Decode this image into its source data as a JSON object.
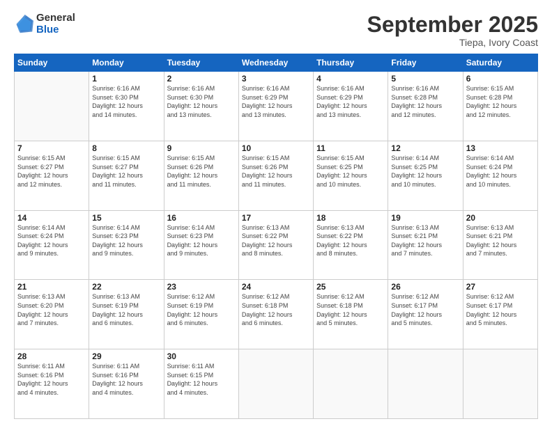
{
  "header": {
    "logo_general": "General",
    "logo_blue": "Blue",
    "month": "September 2025",
    "location": "Tiepa, Ivory Coast"
  },
  "weekdays": [
    "Sunday",
    "Monday",
    "Tuesday",
    "Wednesday",
    "Thursday",
    "Friday",
    "Saturday"
  ],
  "weeks": [
    [
      {
        "day": "",
        "info": ""
      },
      {
        "day": "1",
        "info": "Sunrise: 6:16 AM\nSunset: 6:30 PM\nDaylight: 12 hours\nand 14 minutes."
      },
      {
        "day": "2",
        "info": "Sunrise: 6:16 AM\nSunset: 6:30 PM\nDaylight: 12 hours\nand 13 minutes."
      },
      {
        "day": "3",
        "info": "Sunrise: 6:16 AM\nSunset: 6:29 PM\nDaylight: 12 hours\nand 13 minutes."
      },
      {
        "day": "4",
        "info": "Sunrise: 6:16 AM\nSunset: 6:29 PM\nDaylight: 12 hours\nand 13 minutes."
      },
      {
        "day": "5",
        "info": "Sunrise: 6:16 AM\nSunset: 6:28 PM\nDaylight: 12 hours\nand 12 minutes."
      },
      {
        "day": "6",
        "info": "Sunrise: 6:15 AM\nSunset: 6:28 PM\nDaylight: 12 hours\nand 12 minutes."
      }
    ],
    [
      {
        "day": "7",
        "info": "Sunrise: 6:15 AM\nSunset: 6:27 PM\nDaylight: 12 hours\nand 12 minutes."
      },
      {
        "day": "8",
        "info": "Sunrise: 6:15 AM\nSunset: 6:27 PM\nDaylight: 12 hours\nand 11 minutes."
      },
      {
        "day": "9",
        "info": "Sunrise: 6:15 AM\nSunset: 6:26 PM\nDaylight: 12 hours\nand 11 minutes."
      },
      {
        "day": "10",
        "info": "Sunrise: 6:15 AM\nSunset: 6:26 PM\nDaylight: 12 hours\nand 11 minutes."
      },
      {
        "day": "11",
        "info": "Sunrise: 6:15 AM\nSunset: 6:25 PM\nDaylight: 12 hours\nand 10 minutes."
      },
      {
        "day": "12",
        "info": "Sunrise: 6:14 AM\nSunset: 6:25 PM\nDaylight: 12 hours\nand 10 minutes."
      },
      {
        "day": "13",
        "info": "Sunrise: 6:14 AM\nSunset: 6:24 PM\nDaylight: 12 hours\nand 10 minutes."
      }
    ],
    [
      {
        "day": "14",
        "info": "Sunrise: 6:14 AM\nSunset: 6:24 PM\nDaylight: 12 hours\nand 9 minutes."
      },
      {
        "day": "15",
        "info": "Sunrise: 6:14 AM\nSunset: 6:23 PM\nDaylight: 12 hours\nand 9 minutes."
      },
      {
        "day": "16",
        "info": "Sunrise: 6:14 AM\nSunset: 6:23 PM\nDaylight: 12 hours\nand 9 minutes."
      },
      {
        "day": "17",
        "info": "Sunrise: 6:13 AM\nSunset: 6:22 PM\nDaylight: 12 hours\nand 8 minutes."
      },
      {
        "day": "18",
        "info": "Sunrise: 6:13 AM\nSunset: 6:22 PM\nDaylight: 12 hours\nand 8 minutes."
      },
      {
        "day": "19",
        "info": "Sunrise: 6:13 AM\nSunset: 6:21 PM\nDaylight: 12 hours\nand 7 minutes."
      },
      {
        "day": "20",
        "info": "Sunrise: 6:13 AM\nSunset: 6:21 PM\nDaylight: 12 hours\nand 7 minutes."
      }
    ],
    [
      {
        "day": "21",
        "info": "Sunrise: 6:13 AM\nSunset: 6:20 PM\nDaylight: 12 hours\nand 7 minutes."
      },
      {
        "day": "22",
        "info": "Sunrise: 6:13 AM\nSunset: 6:19 PM\nDaylight: 12 hours\nand 6 minutes."
      },
      {
        "day": "23",
        "info": "Sunrise: 6:12 AM\nSunset: 6:19 PM\nDaylight: 12 hours\nand 6 minutes."
      },
      {
        "day": "24",
        "info": "Sunrise: 6:12 AM\nSunset: 6:18 PM\nDaylight: 12 hours\nand 6 minutes."
      },
      {
        "day": "25",
        "info": "Sunrise: 6:12 AM\nSunset: 6:18 PM\nDaylight: 12 hours\nand 5 minutes."
      },
      {
        "day": "26",
        "info": "Sunrise: 6:12 AM\nSunset: 6:17 PM\nDaylight: 12 hours\nand 5 minutes."
      },
      {
        "day": "27",
        "info": "Sunrise: 6:12 AM\nSunset: 6:17 PM\nDaylight: 12 hours\nand 5 minutes."
      }
    ],
    [
      {
        "day": "28",
        "info": "Sunrise: 6:11 AM\nSunset: 6:16 PM\nDaylight: 12 hours\nand 4 minutes."
      },
      {
        "day": "29",
        "info": "Sunrise: 6:11 AM\nSunset: 6:16 PM\nDaylight: 12 hours\nand 4 minutes."
      },
      {
        "day": "30",
        "info": "Sunrise: 6:11 AM\nSunset: 6:15 PM\nDaylight: 12 hours\nand 4 minutes."
      },
      {
        "day": "",
        "info": ""
      },
      {
        "day": "",
        "info": ""
      },
      {
        "day": "",
        "info": ""
      },
      {
        "day": "",
        "info": ""
      }
    ]
  ]
}
